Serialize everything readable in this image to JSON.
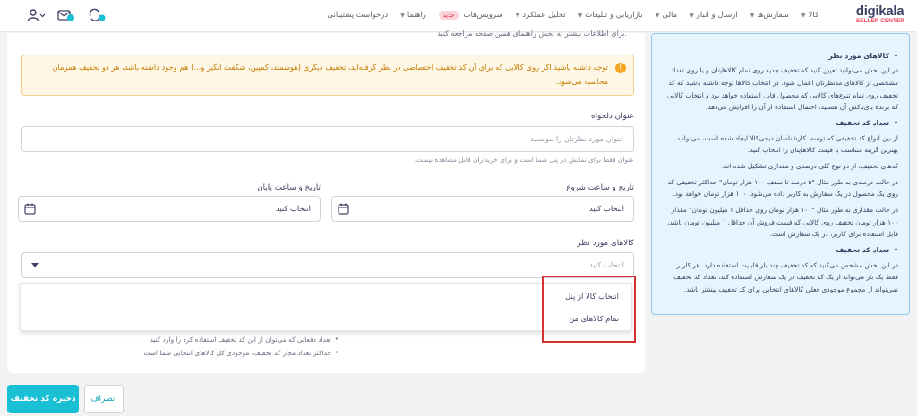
{
  "header": {
    "logo_brand": "digikala",
    "logo_sub": "SELLER CENTER",
    "nav": [
      {
        "label": "کالا"
      },
      {
        "label": "سفارش‌ها"
      },
      {
        "label": "ارسال و انبار"
      },
      {
        "label": "مالی"
      },
      {
        "label": "بازاریابی و تبلیغات"
      },
      {
        "label": "تحلیل عملکرد"
      },
      {
        "label": "سرویس‌هاب",
        "badge": "جدید"
      },
      {
        "label": "راهنما"
      },
      {
        "label": "درخواست پشتیبانی"
      }
    ]
  },
  "form": {
    "top_cut_text": "برای اطلاعات بیشتر به بخش راهنمای همین صفحه مراجعه کنید.",
    "alert_text": "توجه داشته باشید اگر روی کالایی که برای آن کد تخفیف اختصاصی در نظر گرفته‌اید، تخفیف دیگری (هوشمند، کمپین، شگفت انگیز و...) هم وجود داشته باشد، هر دو تخفیف همزمان محاسبه می‌شود.",
    "title_label": "عنوان دلخواه",
    "title_placeholder": "عنوان مورد نظرتان را بنویسید",
    "title_hint": "عنوان فقط برای نمایش در پنل شما است و برای خریداران قابل مشاهده نیست.",
    "start_label": "تاریخ و ساعت شروع",
    "end_label": "تاریخ و ساعت پایان",
    "start_value": "انتخاب کنید",
    "end_value": "انتخاب کنید",
    "products_label": "کالاهای مورد نظر",
    "products_placeholder": "انتخاب کنید",
    "dropdown_options": [
      "انتخاب کالا از پنل",
      "تمام کالاهای من"
    ],
    "bullets": [
      "تعداد دفعاتی که می‌توان از این کد تخفیف استفاده کرد را وارد کنید",
      "حداکثر تعداد مجاز کد تخفیف، موجودی کل کالاهای انتخابی شما است"
    ],
    "save_label": "ذخیره کد تخفیف",
    "cancel_label": "انصراف"
  },
  "help": {
    "sections": [
      {
        "heading": "کالاهای مورد نظر",
        "paragraphs": [
          "در این بخش می‌توانید تعیین کنید که تخفیف جدید روی تمام کالاهایتان و یا روی تعداد مشخصی از کالاهای مدنظرتان اعمال شود. در انتخاب کالاها توجه داشته باشید که کد تخفیف روی تمام تنوع‌های کالایی که محصول قابل استفاده خواهد بود و انتخاب کالایی که برنده بای‌باکس آن هستید، احتمال استفاده از آن را افزایش می‌دهد."
        ]
      },
      {
        "heading": "تعداد کد تخفیف",
        "paragraphs": [
          "از بین انواع کد تخفیفی که توسط کارشناسان دیجی‌کالا ایجاد شده است، می‌توانید بهترین گزینه متناسب با قیمت کالاهایتان را انتخاب کنید.",
          "کدهای تخفیف، از دو نوع کلی درصدی و مقداری تشکیل شده اند.",
          "در حالت درصدی به طور مثال \"۵ درصد تا سقف ۱۰۰ هزار تومان\" حداکثر تخفیفی که روی یک محصول در یک سفارش به کاربر داده می‌شود، ۱۰۰ هزار تومان خواهد بود.",
          "در حالت مقداری به طور مثال \"۱۰۰ هزار تومان روی حداقل ۱ میلیون تومان\" مقدار ۱۰۰ هزار تومان تخفیف روی کالایی که قیمت فروش آن حداقل ۱ میلیون تومان باشد، قابل استفاده برای کاربر، در یک سفارش است."
        ]
      },
      {
        "heading": "تعداد کد تخفیف",
        "paragraphs": [
          "در این بخش مشخص می‌کنید که کد تخفیف چند بار قابلیت استفاده دارد. هر کاربر فقط یک بار می‌تواند از یک کد تخفیف در یک سفارش استفاده کند، تعداد کد تخفیف نمی‌تواند از مجموع موجودی فعلی کالاهای انتخابی برای کد تخفیف بیشتر باشد."
        ]
      }
    ]
  },
  "colors": {
    "primary": "#19bfd3",
    "brand_red": "#ef4056",
    "highlight": "#d6302f"
  }
}
